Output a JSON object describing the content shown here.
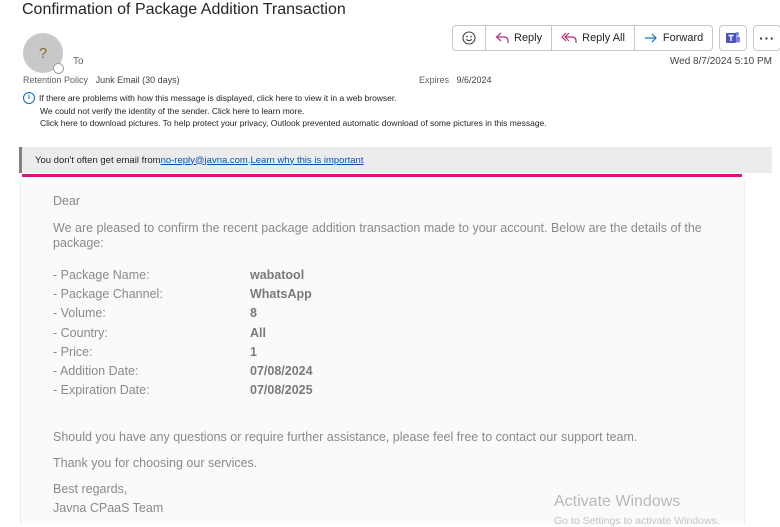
{
  "email": {
    "subject": "Confirmation of Package Addition Transaction",
    "avatar_initial": "?",
    "to_label": "To",
    "date": "Wed 8/7/2024 5:10 PM",
    "retention_label": "Retention Policy",
    "retention_value": "Junk Email (30 days)",
    "expires_label": "Expires",
    "expires_value": "9/6/2024",
    "info_lines": [
      "If there are problems with how this message is displayed, click here to view it in a web browser.",
      "We could not verify the identity of the sender. Click here to learn more.",
      "Click here to download pictures. To help protect your privacy, Outlook prevented automatic download of some pictures in this message."
    ]
  },
  "toolbar": {
    "reply_label": "Reply",
    "reply_all_label": "Reply All",
    "forward_label": "Forward",
    "more_label": "···"
  },
  "banner": {
    "prefix": "You don't often get email from ",
    "sender": "no-reply@javna.com",
    "suffix": ". ",
    "learn_link": "Learn why this is important"
  },
  "body": {
    "greeting": "Dear",
    "intro": "We are pleased to confirm the recent package addition transaction made to your account. Below are the details of the package:",
    "details": [
      {
        "label": "- Package Name:",
        "value": "wabatool"
      },
      {
        "label": "- Package Channel:",
        "value": "WhatsApp"
      },
      {
        "label": "- Volume:",
        "value": "8"
      },
      {
        "label": "- Country:",
        "value": "All"
      },
      {
        "label": "- Price:",
        "value": "1"
      },
      {
        "label": "- Addition Date:",
        "value": "07/08/2024"
      },
      {
        "label": "- Expiration Date:",
        "value": "07/08/2025"
      }
    ],
    "assistance": "Should you have any questions or require further assistance, please feel free to contact our support team.",
    "thanks": "Thank you for choosing our services.",
    "regards": "Best regards,",
    "signature": "Javna CPaaS Team"
  },
  "watermark": {
    "line1": "Activate Windows",
    "line2": "Go to Settings to activate Windows."
  },
  "colors": {
    "accent_pink": "#e2107e",
    "link_blue": "#0f4fb5",
    "teams_purple": "#4b53bc"
  }
}
